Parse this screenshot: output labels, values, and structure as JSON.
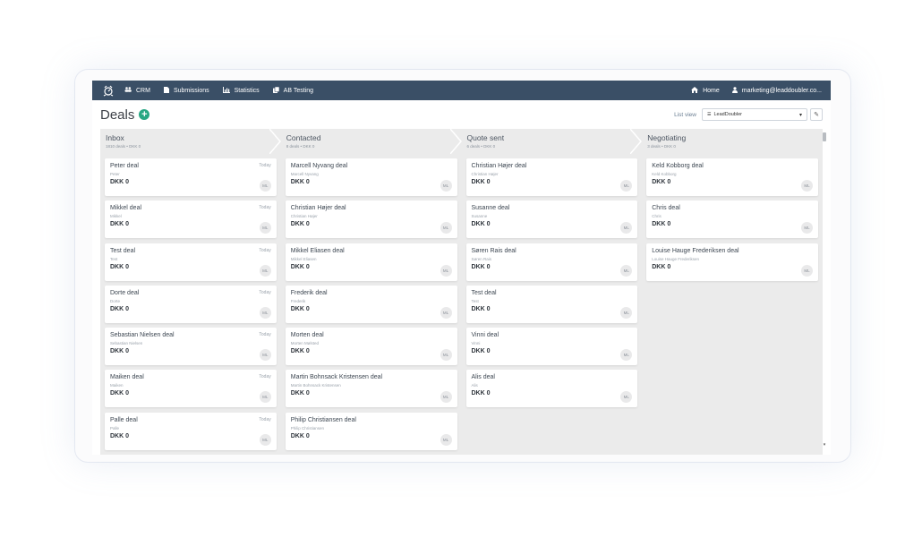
{
  "nav": {
    "crm": "CRM",
    "submissions": "Submissions",
    "statistics": "Statistics",
    "ab_testing": "AB Testing",
    "home": "Home",
    "user": "marketing@leaddoubler.co..."
  },
  "page": {
    "title": "Deals",
    "list_view_label": "List view",
    "list_view_value": "LeadDoubler"
  },
  "stages": [
    {
      "name": "Inbox",
      "meta": "1810 deals • DKK 0",
      "deals": [
        {
          "title": "Peter deal",
          "contact": "Peter",
          "value": "DKK 0",
          "date": "Today",
          "owner": "ML"
        },
        {
          "title": "Mikkel deal",
          "contact": "Mikkel",
          "value": "DKK 0",
          "date": "Today",
          "owner": "ML"
        },
        {
          "title": "Test deal",
          "contact": "Test",
          "value": "DKK 0",
          "date": "Today",
          "owner": "ML"
        },
        {
          "title": "Dorte deal",
          "contact": "Dorte",
          "value": "DKK 0",
          "date": "Today",
          "owner": "ML"
        },
        {
          "title": "Sebastian Nielsen deal",
          "contact": "Sebastian Nielsen",
          "value": "DKK 0",
          "date": "Today",
          "owner": "ML"
        },
        {
          "title": "Maiken deal",
          "contact": "Maiken",
          "value": "DKK 0",
          "date": "Today",
          "owner": "ML"
        },
        {
          "title": "Palle deal",
          "contact": "Palle",
          "value": "DKK 0",
          "date": "Today",
          "owner": "ML"
        }
      ]
    },
    {
      "name": "Contacted",
      "meta": "8 deals • DKK 0",
      "deals": [
        {
          "title": "Marcell Nyvang deal",
          "contact": "Marcell Nyvang",
          "value": "DKK 0",
          "date": "",
          "owner": "ML"
        },
        {
          "title": "Christian Højer deal",
          "contact": "Christian Højer",
          "value": "DKK 0",
          "date": "",
          "owner": "ML"
        },
        {
          "title": "Mikkel Eliasen deal",
          "contact": "Mikkel Eliasen",
          "value": "DKK 0",
          "date": "",
          "owner": "ML"
        },
        {
          "title": "Frederik deal",
          "contact": "Frederik",
          "value": "DKK 0",
          "date": "",
          "owner": "ML"
        },
        {
          "title": "Morten deal",
          "contact": "Morten Mølsted",
          "value": "DKK 0",
          "date": "",
          "owner": "ML"
        },
        {
          "title": "Martin Bohnsack Kristensen deal",
          "contact": "Martin Bohnsack Kristensen",
          "value": "DKK 0",
          "date": "",
          "owner": "ML"
        },
        {
          "title": "Philip Christiansen deal",
          "contact": "Philip Christiansen",
          "value": "DKK 0",
          "date": "",
          "owner": "ML"
        }
      ]
    },
    {
      "name": "Quote sent",
      "meta": "6 deals • DKK 0",
      "deals": [
        {
          "title": "Christian Højer deal",
          "contact": "Christian Højer",
          "value": "DKK 0",
          "date": "",
          "owner": "ML"
        },
        {
          "title": "Susanne deal",
          "contact": "Susanne",
          "value": "DKK 0",
          "date": "",
          "owner": "ML"
        },
        {
          "title": "Søren Rais deal",
          "contact": "Søren Rais",
          "value": "DKK 0",
          "date": "",
          "owner": "ML"
        },
        {
          "title": "Test deal",
          "contact": "Test",
          "value": "DKK 0",
          "date": "",
          "owner": "ML"
        },
        {
          "title": "Vinni deal",
          "contact": "Vinni",
          "value": "DKK 0",
          "date": "",
          "owner": "ML"
        },
        {
          "title": "Alis deal",
          "contact": "Alis",
          "value": "DKK 0",
          "date": "",
          "owner": "ML"
        }
      ]
    },
    {
      "name": "Negotiating",
      "meta": "3 deals • DKK 0",
      "deals": [
        {
          "title": "Keld Kobborg deal",
          "contact": "Keld Kobborg",
          "value": "DKK 0",
          "date": "",
          "owner": "ML"
        },
        {
          "title": "Chris deal",
          "contact": "Chris",
          "value": "DKK 0",
          "date": "",
          "owner": "ML"
        },
        {
          "title": "Louise Hauge Frederiksen deal",
          "contact": "Louise Hauge Frederiksen",
          "value": "DKK 0",
          "date": "",
          "owner": "ML"
        }
      ]
    }
  ],
  "colors": {
    "navbar": "#3a4f66",
    "accent": "#28a783",
    "board_bg": "#ebebeb"
  }
}
